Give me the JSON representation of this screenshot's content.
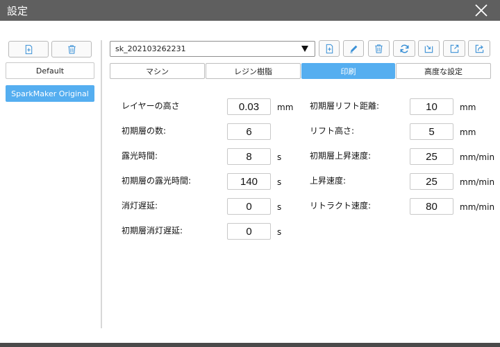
{
  "window": {
    "title": "設定"
  },
  "profiles": {
    "items": [
      "Default",
      "SparkMaker Original"
    ],
    "selected": "SparkMaker Original"
  },
  "preset": {
    "value": "sk_202103262231"
  },
  "toolbar_icons": [
    "add-file-icon",
    "pencil-icon",
    "trash-icon",
    "refresh-icon",
    "import-icon",
    "export-icon",
    "share-icon"
  ],
  "tabs": [
    "マシン",
    "レジン樹脂",
    "印刷",
    "高度な設定"
  ],
  "active_tab": "印刷",
  "params_left": [
    {
      "label": "レイヤーの高さ",
      "value": "0.03",
      "unit": "mm"
    },
    {
      "label": "初期層の数:",
      "value": "6",
      "unit": ""
    },
    {
      "label": "露光時間:",
      "value": "8",
      "unit": "s"
    },
    {
      "label": "初期層の露光時間:",
      "value": "140",
      "unit": "s"
    },
    {
      "label": "消灯遅延:",
      "value": "0",
      "unit": "s"
    },
    {
      "label": "初期層消灯遅延:",
      "value": "0",
      "unit": "s"
    }
  ],
  "params_right": [
    {
      "label": "初期層リフト距離:",
      "value": "10",
      "unit": "mm"
    },
    {
      "label": "リフト高さ:",
      "value": "5",
      "unit": "mm"
    },
    {
      "label": "初期層上昇速度:",
      "value": "25",
      "unit": "mm/min"
    },
    {
      "label": "上昇速度:",
      "value": "25",
      "unit": "mm/min"
    },
    {
      "label": "リトラクト速度:",
      "value": "80",
      "unit": "mm/min"
    }
  ]
}
